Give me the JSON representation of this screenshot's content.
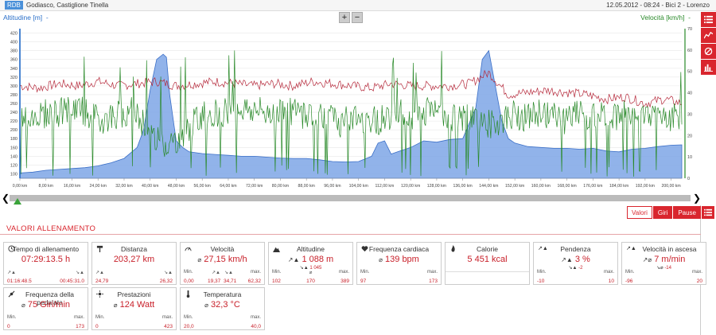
{
  "header": {
    "badge": "RDB",
    "location": "Godiasco, Castiglione Tinella",
    "info": "12.05.2012  -  08:24  -  Bici 2  -  Lorenzo"
  },
  "axis_titles": {
    "left": "Altitudine [m]",
    "left_arrow": "-",
    "right": "Velocità [km/h]",
    "right_arrow": "-"
  },
  "zoom": {
    "plus": "+",
    "minus": "−"
  },
  "side_buttons": [
    "list-icon",
    "line-chart-icon",
    "no-show-icon",
    "bar-chart-icon"
  ],
  "chart_data": {
    "type": "area",
    "x_ticks": [
      "0,00 km",
      "8,00 km",
      "16,00 km",
      "24,00 km",
      "32,00 km",
      "40,00 km",
      "48,00 km",
      "56,00 km",
      "64,00 km",
      "72,00 km",
      "80,00 km",
      "88,00 km",
      "96,00 km",
      "104,00 km",
      "112,00 km",
      "120,00 km",
      "128,00 km",
      "136,00 km",
      "144,00 km",
      "152,00 km",
      "160,00 km",
      "168,00 km",
      "176,00 km",
      "184,00 km",
      "192,00 km",
      "200,00 km"
    ],
    "y_left_ticks": [
      "420",
      "400",
      "380",
      "360",
      "340",
      "320",
      "300",
      "280",
      "260",
      "240",
      "220",
      "200",
      "180",
      "160",
      "140",
      "120",
      "100"
    ],
    "y_right_ticks": [
      "70",
      "60",
      "50",
      "40",
      "30",
      "20",
      "10",
      "0"
    ],
    "xlim": [
      0,
      203.27
    ],
    "ylim_left": [
      90,
      430
    ],
    "ylim_right": [
      0,
      70
    ],
    "altitude": {
      "name": "Altitudine",
      "color": "#4a7fd4",
      "x": [
        0,
        4,
        8,
        12,
        16,
        20,
        24,
        28,
        32,
        36,
        38,
        40,
        42,
        44,
        45,
        46,
        48,
        50,
        52,
        56,
        60,
        64,
        68,
        72,
        76,
        80,
        84,
        88,
        92,
        96,
        100,
        104,
        108,
        110,
        112,
        114,
        116,
        120,
        124,
        128,
        132,
        136,
        140,
        142,
        144,
        146,
        148,
        150,
        152,
        156,
        160,
        164,
        168,
        172,
        176,
        180,
        184,
        188,
        192,
        196,
        200,
        203.27
      ],
      "y": [
        102,
        104,
        108,
        110,
        112,
        114,
        118,
        125,
        135,
        160,
        200,
        290,
        360,
        372,
        365,
        280,
        175,
        160,
        150,
        146,
        144,
        142,
        140,
        140,
        138,
        136,
        135,
        135,
        132,
        128,
        127,
        128,
        140,
        170,
        175,
        145,
        150,
        160,
        175,
        172,
        178,
        180,
        250,
        360,
        380,
        300,
        220,
        180,
        170,
        162,
        160,
        158,
        158,
        156,
        158,
        152,
        150,
        156,
        158,
        162,
        165,
        166
      ]
    },
    "speed": {
      "name": "Velocità",
      "color": "#2a8a2a",
      "x": [
        0,
        6,
        12,
        18,
        24,
        30,
        34,
        38,
        42,
        46,
        50,
        56,
        62,
        68,
        74,
        80,
        86,
        92,
        98,
        104,
        110,
        116,
        122,
        128,
        134,
        140,
        144,
        148,
        152,
        156,
        160,
        164,
        168,
        172,
        176,
        180,
        184,
        188,
        192,
        196,
        200,
        203.27
      ],
      "y": [
        28,
        30,
        31,
        33,
        27,
        30,
        32,
        26,
        18,
        16,
        20,
        30,
        31,
        33,
        31,
        32,
        30,
        31,
        26,
        28,
        27,
        31,
        29,
        33,
        27,
        28,
        25,
        27,
        30,
        28,
        31,
        29,
        27,
        32,
        28,
        31,
        29,
        30,
        30,
        31,
        28,
        30
      ]
    },
    "heart_rate": {
      "name": "Frequenza cardiaca",
      "color": "#b5283a",
      "x": [
        0,
        6,
        12,
        18,
        24,
        30,
        36,
        42,
        48,
        54,
        60,
        66,
        72,
        78,
        84,
        90,
        96,
        102,
        108,
        114,
        120,
        126,
        132,
        138,
        144,
        150,
        156,
        162,
        168,
        174,
        180,
        186,
        192,
        198,
        203.27
      ],
      "y": [
        300,
        295,
        305,
        300,
        310,
        300,
        305,
        310,
        300,
        305,
        310,
        305,
        300,
        305,
        300,
        310,
        305,
        300,
        295,
        305,
        300,
        300,
        300,
        305,
        330,
        280,
        285,
        290,
        285,
        280,
        270,
        275,
        260,
        270,
        260
      ]
    },
    "marker_km": 0
  },
  "scroller": {
    "left": "❮",
    "right": "❯"
  },
  "tabs": {
    "valori": "Valori",
    "giri": "Giri",
    "pause": "Pause"
  },
  "section": {
    "title": "VALORI ALLENAMENTO"
  },
  "cards": {
    "tempo": {
      "title": "Tempo di allenamento",
      "value": "07:29:13.5 h",
      "min": "01:16:48.5",
      "max": "00:45:31.0"
    },
    "distanza": {
      "title": "Distanza",
      "value": "203,27 km",
      "min": "24,79",
      "max": "26,32"
    },
    "velocita": {
      "title": "Velocità",
      "pre": "⌀",
      "value": "27,15 km/h",
      "min_lbl": "Min.",
      "max_lbl": "max.",
      "min": "0,00",
      "up": "19,37",
      "down": "34,71",
      "max": "62,32"
    },
    "altitudine": {
      "title": "Altitudine",
      "up_value": "1 088 m",
      "down_value": "1 045",
      "min_lbl": "Min.",
      "mid_lbl": "⌀",
      "max_lbl": "max.",
      "min": "102",
      "mid": "170",
      "max": "389"
    },
    "freq": {
      "title": "Frequenza cardiaca",
      "pre": "⌀",
      "value": "139 bpm",
      "min_lbl": "Min.",
      "max_lbl": "max.",
      "min": "97",
      "max": "173"
    },
    "calorie": {
      "title": "Calorie",
      "value": "5 451 kcal"
    },
    "pendenza": {
      "title": "Pendenza",
      "value": "3 %",
      "sub": "-2",
      "min_lbl": "Min.",
      "max_lbl": "max.",
      "min": "-10",
      "max": "10"
    },
    "ascesa": {
      "title": "Velocità in ascesa",
      "value": "7 m/min",
      "sub": "-14",
      "min_lbl": "Min.",
      "max_lbl": "max.",
      "min": "-96",
      "max": "20"
    },
    "pedalata": {
      "title": "Frequenza della pedalata",
      "pre": "⌀",
      "value": "75 Giri/min",
      "min_lbl": "Min.",
      "max_lbl": "max.",
      "min": "0",
      "max": "173"
    },
    "prestazioni": {
      "title": "Prestazioni",
      "pre": "⌀",
      "value": "124 Watt",
      "min_lbl": "Min.",
      "max_lbl": "max.",
      "min": "0",
      "max": "423"
    },
    "temperatura": {
      "title": "Temperatura",
      "pre": "⌀",
      "value": "32,3 °C",
      "min_lbl": "Min.",
      "max_lbl": "max.",
      "min": "20,0",
      "max": "40,0"
    }
  }
}
